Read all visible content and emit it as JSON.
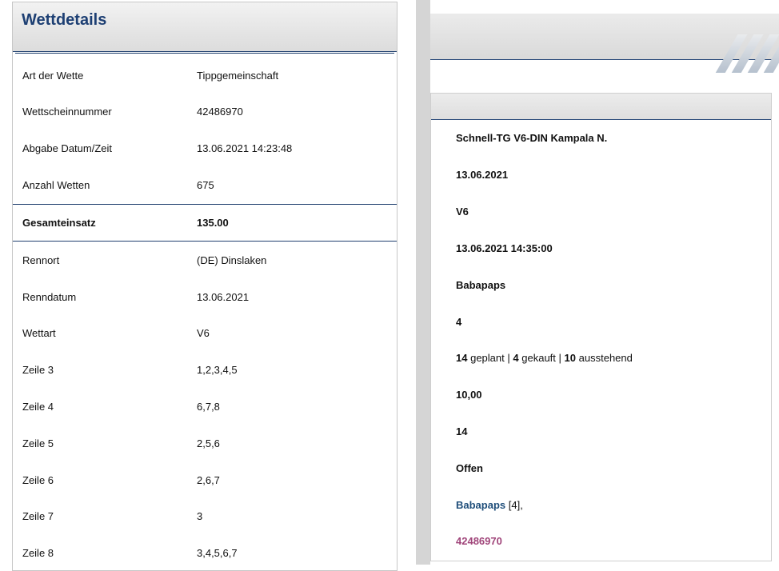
{
  "modal": {
    "title": "Wettdetails",
    "rows_top": [
      {
        "label": "Art der Wette",
        "value": "Tippgemeinschaft"
      },
      {
        "label": "Wettscheinnummer",
        "value": "42486970"
      },
      {
        "label": "Abgabe Datum/Zeit",
        "value": "13.06.2021 14:23:48"
      },
      {
        "label": "Anzahl Wetten",
        "value": "675"
      }
    ],
    "total": {
      "label": "Gesamteinsatz",
      "value": "135.00"
    },
    "rows_bottom": [
      {
        "label": "Rennort",
        "value": "(DE) Dinslaken"
      },
      {
        "label": "Renndatum",
        "value": "13.06.2021"
      },
      {
        "label": "Wettart",
        "value": "V6"
      },
      {
        "label": "Zeile 3",
        "value": "1,2,3,4,5"
      },
      {
        "label": "Zeile 4",
        "value": "6,7,8"
      },
      {
        "label": "Zeile 5",
        "value": "2,5,6"
      },
      {
        "label": "Zeile 6",
        "value": "2,6,7"
      },
      {
        "label": "Zeile 7",
        "value": "3"
      },
      {
        "label": "Zeile 8",
        "value": "3,4,5,6,7"
      }
    ]
  },
  "background_panel": {
    "name": "Schnell-TG V6-DIN Kampala N.",
    "date": "13.06.2021",
    "bet_type": "V6",
    "datetime": "13.06.2021 14:35:00",
    "organizer": "Babapaps",
    "count": "4",
    "shares": {
      "planned": "14",
      "planned_label": "geplant",
      "sep1": "|",
      "bought": "4",
      "bought_label": "gekauft",
      "sep2": "|",
      "pending": "10",
      "pending_label": "ausstehend"
    },
    "price": "10,00",
    "total_shares": "14",
    "status": "Offen",
    "member_link": "Babapaps",
    "member_suffix": "[4],",
    "ticket_link": "42486970"
  }
}
